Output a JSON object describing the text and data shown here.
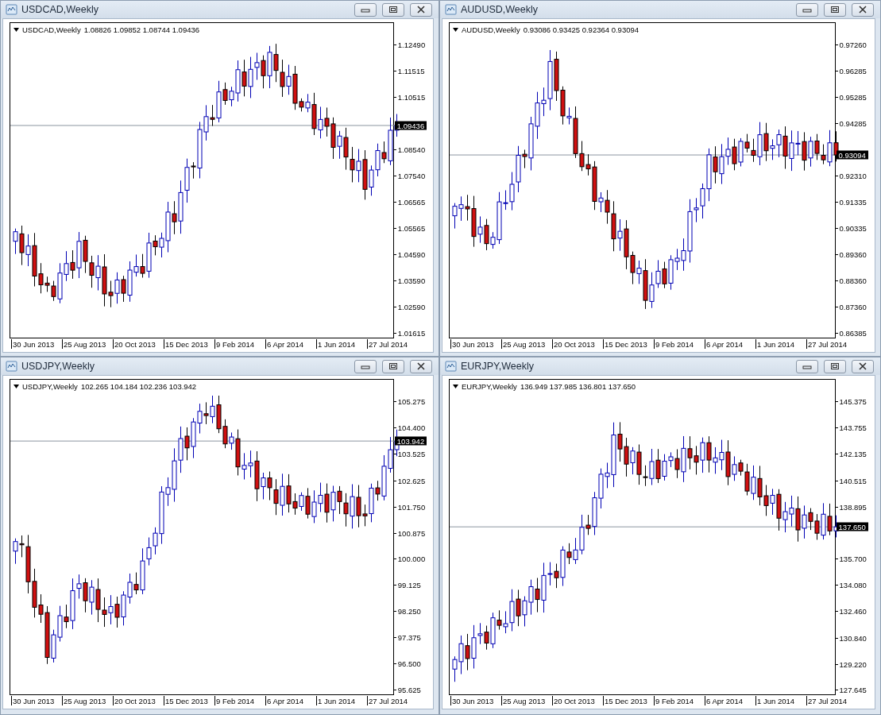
{
  "windows": [
    {
      "title": "USDCAD,Weekly",
      "symbol": "USDCAD,Weekly",
      "ohlc": "1.08826 1.09852 1.08744 1.09436",
      "price": "1.09436",
      "y_labels": [
        "1.12490",
        "1.11515",
        "1.10515",
        "1.08540",
        "1.07540",
        "1.06565",
        "1.05565",
        "1.04590",
        "1.03590",
        "1.02590",
        "1.01615"
      ],
      "x_labels": [
        "30 Jun 2013",
        "25 Aug 2013",
        "20 Oct 2013",
        "15 Dec 2013",
        "9 Feb 2014",
        "6 Apr 2014",
        "1 Jun 2014",
        "27 Jul 2014"
      ]
    },
    {
      "title": "AUDUSD,Weekly",
      "symbol": "AUDUSD,Weekly",
      "ohlc": "0.93086 0.93425 0.92364 0.93094",
      "price": "0.93094",
      "y_labels": [
        "0.97260",
        "0.96285",
        "0.95285",
        "0.94285",
        "0.92310",
        "0.91335",
        "0.90335",
        "0.89360",
        "0.88360",
        "0.87360",
        "0.86385"
      ],
      "x_labels": [
        "30 Jun 2013",
        "25 Aug 2013",
        "20 Oct 2013",
        "15 Dec 2013",
        "9 Feb 2014",
        "6 Apr 2014",
        "1 Jun 2014",
        "27 Jul 2014"
      ]
    },
    {
      "title": "USDJPY,Weekly",
      "symbol": "USDJPY,Weekly",
      "ohlc": "102.265 104.184 102.236 103.942",
      "price": "103.942",
      "y_labels": [
        "105.275",
        "104.400",
        "103.525",
        "102.625",
        "101.750",
        "100.875",
        "100.000",
        "99.125",
        "98.250",
        "97.375",
        "96.500",
        "95.625"
      ],
      "x_labels": [
        "30 Jun 2013",
        "25 Aug 2013",
        "20 Oct 2013",
        "15 Dec 2013",
        "9 Feb 2014",
        "6 Apr 2014",
        "1 Jun 2014",
        "27 Jul 2014"
      ]
    },
    {
      "title": "EURJPY,Weekly",
      "symbol": "EURJPY,Weekly",
      "ohlc": "136.949 137.985 136.801 137.650",
      "price": "137.650",
      "y_labels": [
        "145.375",
        "143.755",
        "142.135",
        "140.515",
        "138.895",
        "135.700",
        "134.080",
        "132.460",
        "130.840",
        "129.220",
        "127.645"
      ],
      "x_labels": [
        "30 Jun 2013",
        "25 Aug 2013",
        "20 Oct 2013",
        "15 Dec 2013",
        "9 Feb 2014",
        "6 Apr 2014",
        "1 Jun 2014",
        "27 Jul 2014"
      ]
    }
  ]
}
